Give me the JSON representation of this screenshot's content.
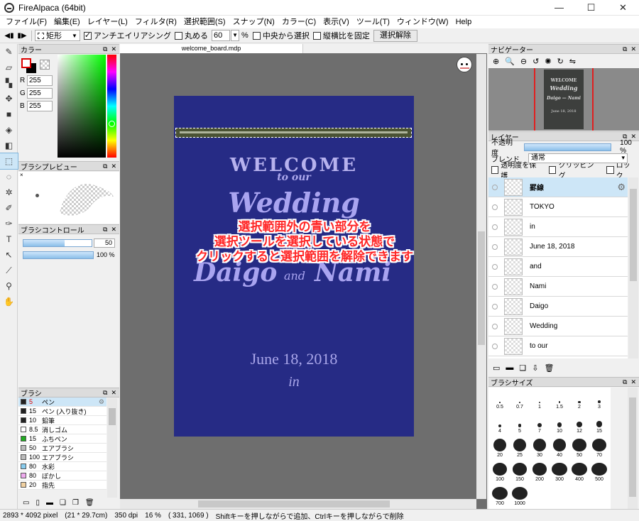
{
  "window": {
    "title": "FireAlpaca (64bit)",
    "minimize": "—",
    "maximize": "☐",
    "close": "✕"
  },
  "menu": [
    "ファイル(F)",
    "編集(E)",
    "レイヤー(L)",
    "フィルタ(R)",
    "選択範囲(S)",
    "スナップ(N)",
    "カラー(C)",
    "表示(V)",
    "ツール(T)",
    "ウィンドウ(W)",
    "Help"
  ],
  "toolbar": {
    "shape": "矩形",
    "antialias": "アンチエイリアシング",
    "round": "丸める",
    "round_value": "60",
    "percent": "%",
    "from_center": "中央から選択",
    "fix_ratio": "縦横比を固定",
    "deselect": "選択解除"
  },
  "color_panel": {
    "title": "カラー",
    "r_label": "R",
    "g_label": "G",
    "b_label": "B",
    "r": "255",
    "g": "255",
    "b": "255"
  },
  "brush_preview": {
    "title": "ブラシプレビュー",
    "marker": "×"
  },
  "brush_control": {
    "title": "ブラシコントロール",
    "size": "50",
    "opacity": "100 %",
    "size_fraction": 0.6,
    "opacity_fraction": 1.0
  },
  "brush_list": {
    "title": "ブラシ",
    "items": [
      {
        "size": "5",
        "name": "ペン",
        "color": "#222222",
        "selected": true
      },
      {
        "size": "15",
        "name": "ペン (入り抜き)",
        "color": "#222222"
      },
      {
        "size": "10",
        "name": "鉛筆",
        "color": "#222222"
      },
      {
        "size": "8.5",
        "name": "消しゴム",
        "color": "#ffffff"
      },
      {
        "size": "15",
        "name": "ふちペン",
        "color": "#22aa22"
      },
      {
        "size": "50",
        "name": "エアブラシ",
        "color": "#bbbbbb"
      },
      {
        "size": "100",
        "name": "エアブラシ",
        "color": "#bbbbbb"
      },
      {
        "size": "80",
        "name": "水彩",
        "color": "#88ccee"
      },
      {
        "size": "80",
        "name": "ぼかし",
        "color": "#eeaaee"
      },
      {
        "size": "20",
        "name": "指先",
        "color": "#f0d0a0"
      }
    ]
  },
  "document": {
    "tab": "welcome_board.mdp",
    "welcome": "WELCOME",
    "to_our": "to our",
    "wedding": "Wedding",
    "daigo": "Daigo",
    "and": "and",
    "nami": "Nami",
    "date": "June 18, 2018",
    "in": "in"
  },
  "overlay_note": [
    "選択範囲外の青い部分を",
    "選択ツールを選択している状態で",
    "クリックすると選択範囲を解除できます"
  ],
  "navigator": {
    "title": "ナビゲーター",
    "preview_welcome": "WELCOME",
    "preview_wedding": "Wedding",
    "preview_names": "Daigo — Nami",
    "preview_date": "June 18, 2018"
  },
  "layers": {
    "title": "レイヤー",
    "opacity_label": "不透明度",
    "opacity_value": "100 %",
    "blend_label": "ブレンド",
    "blend_value": "通常",
    "protect": "透明度を保護",
    "clipping": "クリッピング",
    "lock": "ロック",
    "items": [
      {
        "name": "罫線",
        "selected": true
      },
      {
        "name": "TOKYO"
      },
      {
        "name": "in"
      },
      {
        "name": "June 18, 2018"
      },
      {
        "name": "and"
      },
      {
        "name": "Nami"
      },
      {
        "name": "Daigo"
      },
      {
        "name": "Wedding"
      },
      {
        "name": "to our"
      }
    ]
  },
  "brush_size": {
    "title": "ブラシサイズ",
    "sizes": [
      "0.5",
      "0.7",
      "1",
      "1.5",
      "2",
      "3",
      "4",
      "5",
      "7",
      "10",
      "12",
      "15",
      "20",
      "25",
      "30",
      "40",
      "50",
      "70",
      "100",
      "150",
      "200",
      "300",
      "400",
      "500",
      "700",
      "1000"
    ]
  },
  "status": {
    "pixels": "2893 * 4092 pixel",
    "cm": "(21 * 29.7cm)",
    "dpi": "350 dpi",
    "zoom": "16 %",
    "coords": "( 331, 1069 )",
    "hint": "Shiftキーを押しながらで追加、Ctrlキーを押しながらで削除"
  }
}
